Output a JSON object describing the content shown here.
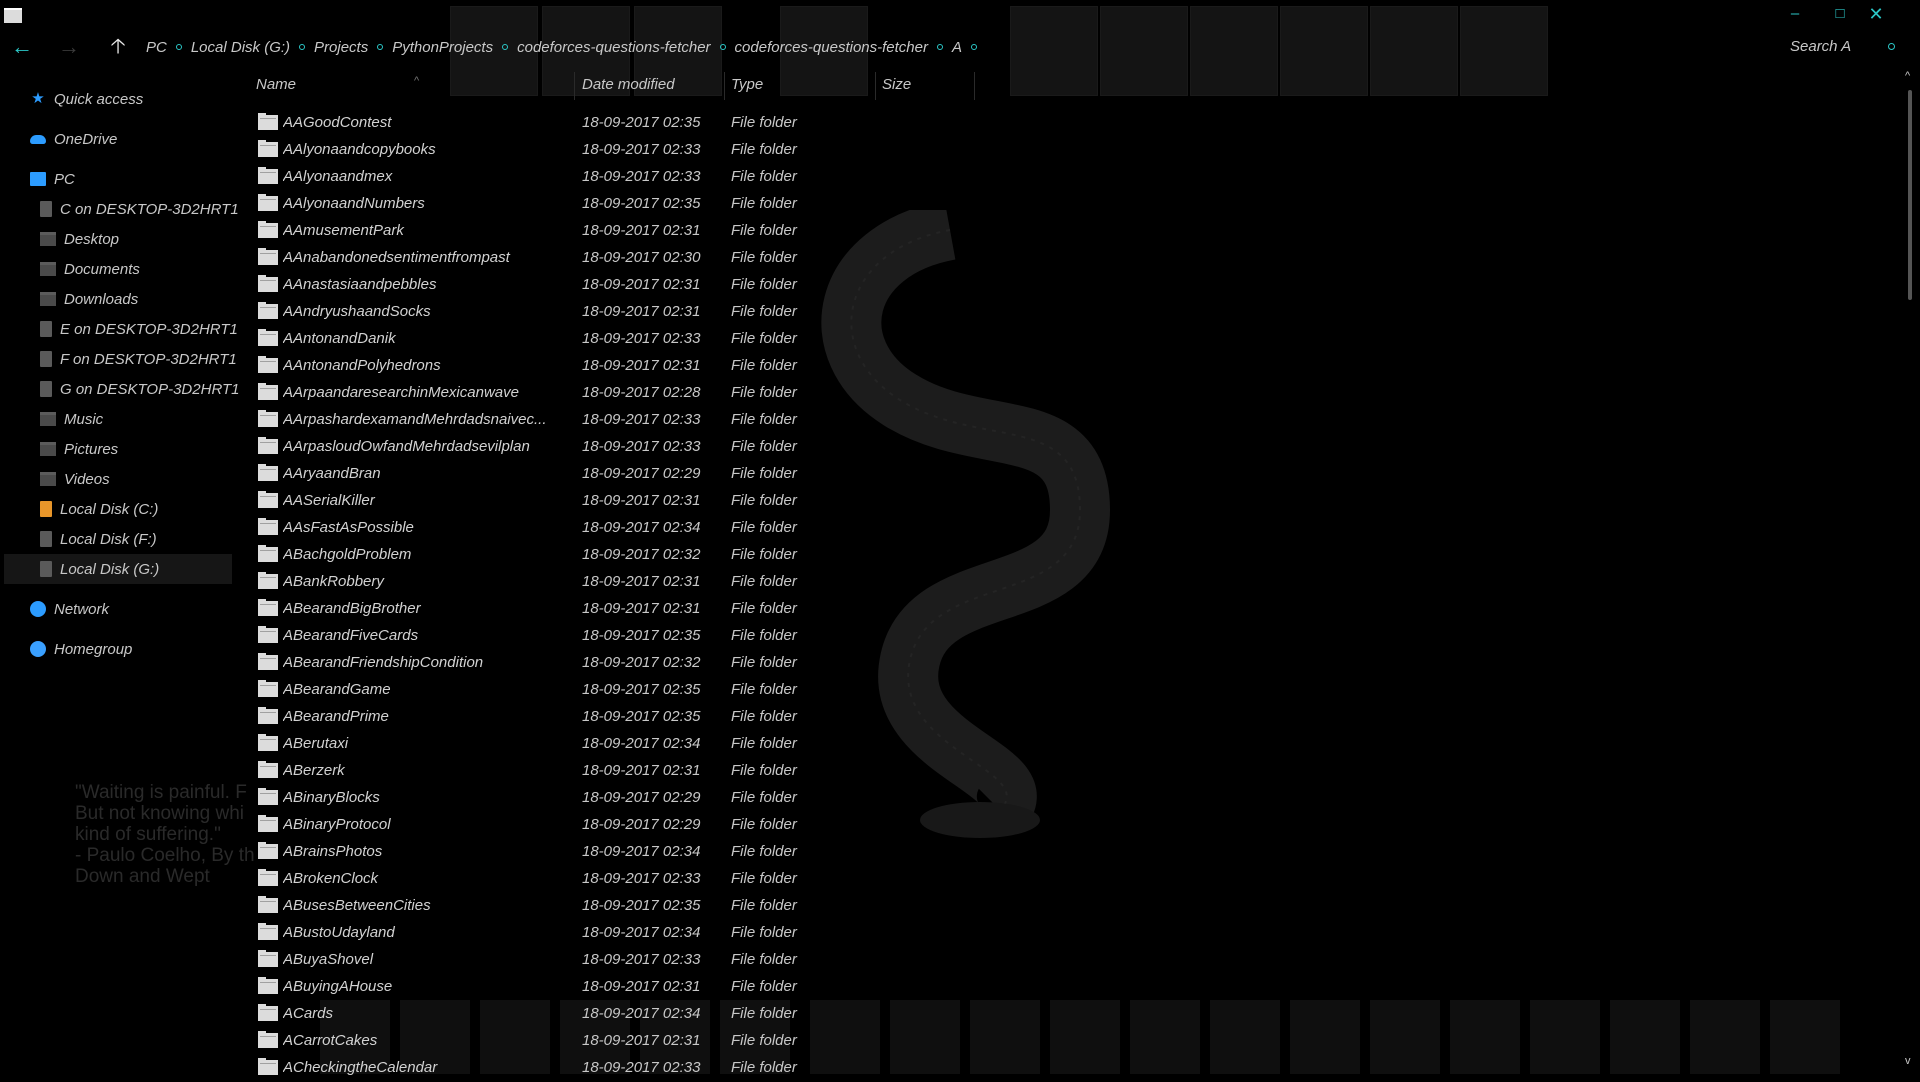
{
  "window": {
    "minimize_glyph": "–",
    "maximize_glyph": "□",
    "close_glyph": "✕"
  },
  "nav_buttons": {
    "back_glyph": "←",
    "forward_glyph": "→",
    "up_glyph": "🡡"
  },
  "breadcrumb": [
    "PC",
    "Local Disk (G:)",
    "Projects",
    "PythonProjects",
    "codeforces-questions-fetcher",
    "codeforces-questions-fetcher",
    "A"
  ],
  "search": {
    "placeholder": "Search A"
  },
  "sidebar": {
    "items": [
      {
        "label": "Quick access",
        "icon": "star-icon"
      },
      {
        "label": "OneDrive",
        "icon": "cloud-icon"
      },
      {
        "label": "PC",
        "icon": "computer-icon"
      },
      {
        "label": "C on DESKTOP-3D2HRT1",
        "icon": "network-drive-icon"
      },
      {
        "label": "Desktop",
        "icon": "folder-icon"
      },
      {
        "label": "Documents",
        "icon": "folder-icon"
      },
      {
        "label": "Downloads",
        "icon": "folder-icon"
      },
      {
        "label": "E on DESKTOP-3D2HRT1",
        "icon": "network-drive-icon"
      },
      {
        "label": "F on DESKTOP-3D2HRT1",
        "icon": "network-drive-icon"
      },
      {
        "label": "G on DESKTOP-3D2HRT1",
        "icon": "network-drive-icon"
      },
      {
        "label": "Music",
        "icon": "folder-icon"
      },
      {
        "label": "Pictures",
        "icon": "folder-icon"
      },
      {
        "label": "Videos",
        "icon": "folder-icon"
      },
      {
        "label": "Local Disk (C:)",
        "icon": "drive-icon"
      },
      {
        "label": "Local Disk (F:)",
        "icon": "drive-icon"
      },
      {
        "label": "Local Disk (G:)",
        "icon": "drive-icon"
      },
      {
        "label": "Network",
        "icon": "network-icon"
      },
      {
        "label": "Homegroup",
        "icon": "homegroup-icon"
      }
    ]
  },
  "columns": {
    "name": "Name",
    "date_modified": "Date modified",
    "type": "Type",
    "size": "Size"
  },
  "files": [
    {
      "name": "AAGoodContest",
      "date": "18-09-2017 02:35",
      "type": "File folder"
    },
    {
      "name": "AAlyonaandcopybooks",
      "date": "18-09-2017 02:33",
      "type": "File folder"
    },
    {
      "name": "AAlyonaandmex",
      "date": "18-09-2017 02:33",
      "type": "File folder"
    },
    {
      "name": "AAlyonaandNumbers",
      "date": "18-09-2017 02:35",
      "type": "File folder"
    },
    {
      "name": "AAmusementPark",
      "date": "18-09-2017 02:31",
      "type": "File folder"
    },
    {
      "name": "AAnabandonedsentimentfrompast",
      "date": "18-09-2017 02:30",
      "type": "File folder"
    },
    {
      "name": "AAnastasiaandpebbles",
      "date": "18-09-2017 02:31",
      "type": "File folder"
    },
    {
      "name": "AAndryushaandSocks",
      "date": "18-09-2017 02:31",
      "type": "File folder"
    },
    {
      "name": "AAntonandDanik",
      "date": "18-09-2017 02:33",
      "type": "File folder"
    },
    {
      "name": "AAntonandPolyhedrons",
      "date": "18-09-2017 02:31",
      "type": "File folder"
    },
    {
      "name": "AArpaandaresearchinMexicanwave",
      "date": "18-09-2017 02:28",
      "type": "File folder"
    },
    {
      "name": "AArpashardexamandMehrdadsnaivec...",
      "date": "18-09-2017 02:33",
      "type": "File folder"
    },
    {
      "name": "AArpasloudOwfandMehrdadsevilplan",
      "date": "18-09-2017 02:33",
      "type": "File folder"
    },
    {
      "name": "AAryaandBran",
      "date": "18-09-2017 02:29",
      "type": "File folder"
    },
    {
      "name": "AASerialKiller",
      "date": "18-09-2017 02:31",
      "type": "File folder"
    },
    {
      "name": "AAsFastAsPossible",
      "date": "18-09-2017 02:34",
      "type": "File folder"
    },
    {
      "name": "ABachgoldProblem",
      "date": "18-09-2017 02:32",
      "type": "File folder"
    },
    {
      "name": "ABankRobbery",
      "date": "18-09-2017 02:31",
      "type": "File folder"
    },
    {
      "name": "ABearandBigBrother",
      "date": "18-09-2017 02:31",
      "type": "File folder"
    },
    {
      "name": "ABearandFiveCards",
      "date": "18-09-2017 02:35",
      "type": "File folder"
    },
    {
      "name": "ABearandFriendshipCondition",
      "date": "18-09-2017 02:32",
      "type": "File folder"
    },
    {
      "name": "ABearandGame",
      "date": "18-09-2017 02:35",
      "type": "File folder"
    },
    {
      "name": "ABearandPrime",
      "date": "18-09-2017 02:35",
      "type": "File folder"
    },
    {
      "name": "ABerutaxi",
      "date": "18-09-2017 02:34",
      "type": "File folder"
    },
    {
      "name": "ABerzerk",
      "date": "18-09-2017 02:31",
      "type": "File folder"
    },
    {
      "name": "ABinaryBlocks",
      "date": "18-09-2017 02:29",
      "type": "File folder"
    },
    {
      "name": "ABinaryProtocol",
      "date": "18-09-2017 02:29",
      "type": "File folder"
    },
    {
      "name": "ABrainsPhotos",
      "date": "18-09-2017 02:34",
      "type": "File folder"
    },
    {
      "name": "ABrokenClock",
      "date": "18-09-2017 02:33",
      "type": "File folder"
    },
    {
      "name": "ABusesBetweenCities",
      "date": "18-09-2017 02:35",
      "type": "File folder"
    },
    {
      "name": "ABustoUdayland",
      "date": "18-09-2017 02:34",
      "type": "File folder"
    },
    {
      "name": "ABuyaShovel",
      "date": "18-09-2017 02:33",
      "type": "File folder"
    },
    {
      "name": "ABuyingAHouse",
      "date": "18-09-2017 02:31",
      "type": "File folder"
    },
    {
      "name": "ACards",
      "date": "18-09-2017 02:34",
      "type": "File folder"
    },
    {
      "name": "ACarrotCakes",
      "date": "18-09-2017 02:31",
      "type": "File folder"
    },
    {
      "name": "ACheckingtheCalendar",
      "date": "18-09-2017 02:33",
      "type": "File folder"
    }
  ],
  "background_quote": {
    "lines": [
      "\"Waiting is painful. F",
      "But not knowing whi",
      "kind of suffering.\"",
      "- Paulo Coelho, By th",
      "Down and Wept"
    ]
  },
  "colors": {
    "accent": "#2bc7c7",
    "blue_icon": "#2c9cff",
    "background": "#000000",
    "text": "#c8c8c8"
  }
}
